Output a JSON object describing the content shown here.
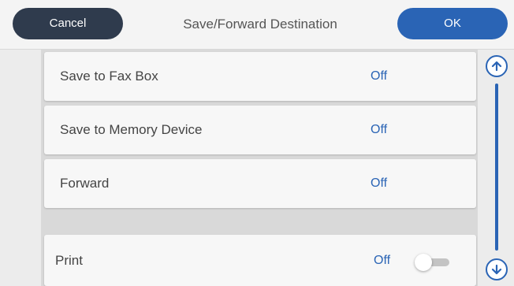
{
  "header": {
    "cancel_label": "Cancel",
    "title": "Save/Forward Destination",
    "ok_label": "OK"
  },
  "rows": [
    {
      "label": "Save to Fax Box",
      "value": "Off"
    },
    {
      "label": "Save to Memory Device",
      "value": "Off"
    },
    {
      "label": "Forward",
      "value": "Off"
    },
    {
      "label": "Print",
      "value": "Off",
      "toggle": "off"
    }
  ],
  "icons": {
    "scroll_up": "arrow-up-icon",
    "scroll_down": "arrow-down-icon"
  },
  "colors": {
    "accent": "#2a64b5",
    "cancel": "#2f3b4d"
  }
}
